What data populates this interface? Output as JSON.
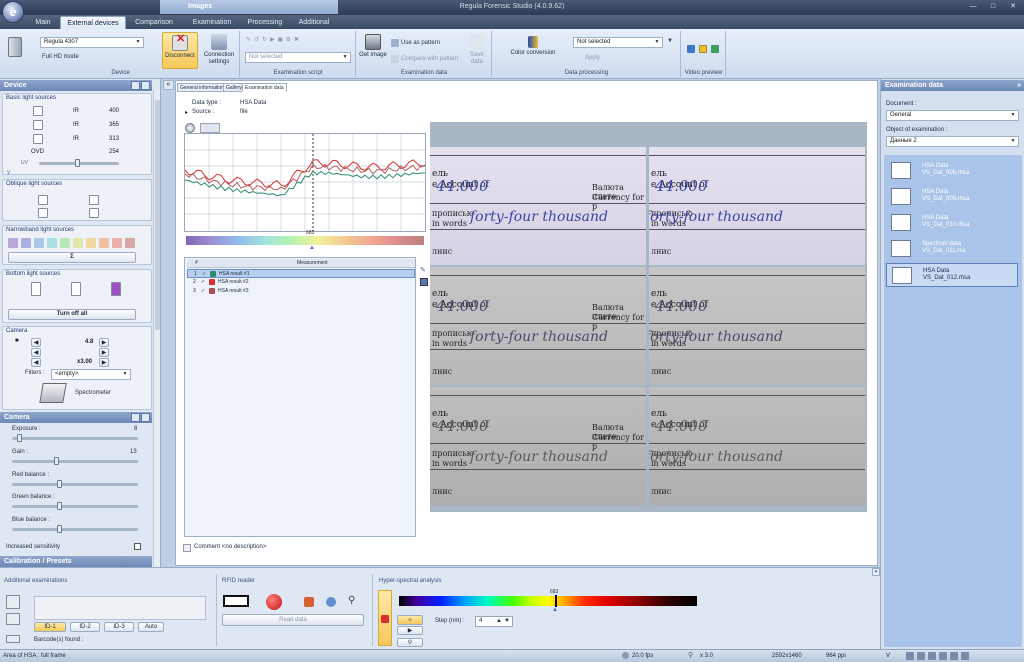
{
  "window": {
    "title": "Regula Forensic Studio (4.0.9.62)",
    "context_tab": "Images"
  },
  "tabs": [
    "Main",
    "External devices",
    "Comparison",
    "Examination",
    "Processing",
    "Additional"
  ],
  "active_tab": "External devices",
  "ribbon": {
    "device": {
      "combo_value": "Regula 4307",
      "full_hd": "Full HD mode",
      "disconnect": "Disconnect",
      "connection_settings": "Connection settings",
      "label": "Device"
    },
    "exam_script": {
      "combo_value": "Not selected",
      "label": "Examination script"
    },
    "exam_data": {
      "get_image": "Get image",
      "use_as_pattern": "Use as pattern",
      "compare_with_pattern": "Compare with pattern",
      "save_data": "Save data",
      "label": "Examination data"
    },
    "data_processing": {
      "color_conversion": "Color conversion",
      "combo_value": "Not selected",
      "apply": "Apply",
      "label": "Data processing"
    },
    "video_preview": {
      "label": "Video preview"
    }
  },
  "left_panel": {
    "device_header": "Device",
    "basic_light": {
      "title": "Basic light sources",
      "items": [
        {
          "code": "IR",
          "value": "400"
        },
        {
          "code": "IR",
          "value": "365"
        },
        {
          "code": "IR",
          "value": "313"
        },
        {
          "code": "OVD",
          "value": "254"
        }
      ],
      "uv": "UV",
      "v": "V"
    },
    "oblique": {
      "title": "Oblique light sources"
    },
    "narrowband": {
      "title": "Narrowband light sources",
      "sum": "Σ"
    },
    "bottom_light": {
      "title": "Bottom light sources",
      "turn_off": "Turn off all"
    },
    "camera": {
      "title": "Camera",
      "v1": "4.8",
      "v2": "x3.00",
      "filters_label": "Filters :",
      "filters_value": "<empty>",
      "spectrometer": "Spectrometer"
    },
    "camera_panel": {
      "header": "Camera",
      "exposure_label": "Exposure :",
      "exposure_value": "8",
      "exposure_fraction": 0.04,
      "gain_label": "Gain :",
      "gain_value": "13",
      "gain_fraction": 0.35,
      "red_label": "Red balance :",
      "red_fraction": 0.37,
      "green_label": "Green balance :",
      "green_fraction": 0.37,
      "blue_label": "Blue balance :",
      "blue_fraction": 0.37,
      "increased_sensitivity": "Increased sensitivity"
    },
    "calibration": "Calibration / Presets"
  },
  "center": {
    "tabs": [
      "General information",
      "Gallery",
      "Examination data"
    ],
    "data_type_label": "Data type :",
    "data_type_value": "HSA Data",
    "source_label": "Source :",
    "source_value": "file",
    "marker_value": "683",
    "table": {
      "headers": [
        "#",
        "Measurement"
      ],
      "rows": [
        {
          "n": "1",
          "name": "HSA result #1",
          "color": "#2e8b6e"
        },
        {
          "n": "2",
          "name": "HSA result #2",
          "color": "#d83030"
        },
        {
          "n": "3",
          "name": "HSA result #3",
          "color": "#b05050"
        }
      ]
    },
    "comment_label": "Comment :",
    "comment_value": "<no description>",
    "document": {
      "rows": [
        {
          "amount": "44.000",
          "words": "forty-four  thousand",
          "account": "e Account of",
          "currency": "Валюта плате",
          "currency2": "Currency for p",
          "words_label": "прописью",
          "in_words": "in words",
          "edge": "ель",
          "sign": "лнис"
        }
      ]
    }
  },
  "right_panel": {
    "header": "Examination data",
    "document_label": "Document :",
    "document_value": "General",
    "object_label": "Object of examination :",
    "object_value": "Данные 2",
    "items": [
      {
        "type": "HSA Data",
        "file": "VS_Dat_005.rhsa"
      },
      {
        "type": "HSA Data",
        "file": "VS_Dat_009.rhsa"
      },
      {
        "type": "HSA Data",
        "file": "VS_Dat_010.rhsa"
      },
      {
        "type": "Spectrum data",
        "file": "VS_Dat_011.rsa"
      },
      {
        "type": "HSA Data",
        "file": "VS_Dat_012.rhsa"
      }
    ]
  },
  "bottom": {
    "additional_title": "Additional examinations",
    "id_tabs": [
      "ID-1",
      "ID-2",
      "ID-3",
      "Auto"
    ],
    "barcodes": "Barcode(s) found :",
    "rfid_title": "RFID reader",
    "read_data": "Read data",
    "hsa_title": "Hyper-spectral analysis",
    "hsa_marker": "683",
    "step_label": "Step (nm) :",
    "step_value": "4"
  },
  "status": {
    "area": "Area of HSA :",
    "area_value": "full frame",
    "fps": "20.0 fps",
    "zoom": "x 3.0",
    "resolution": "2592x1460",
    "ppi": "964 ppi"
  },
  "colors": {
    "accent": "#6d88b6",
    "hsa_line_1": "#2e8b6e",
    "hsa_line_2": "#d83030"
  }
}
